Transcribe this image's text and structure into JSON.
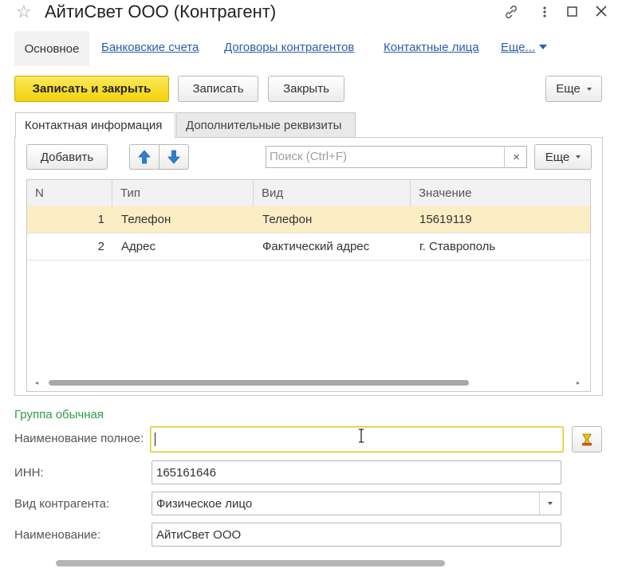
{
  "window": {
    "title": "АйтиСвет ООО (Контрагент)",
    "icons": [
      "star-icon",
      "link-icon",
      "more-vertical-icon",
      "maximize-icon",
      "close-icon"
    ]
  },
  "nav": {
    "tabs": [
      "Основное",
      "Банковские счета",
      "Договоры контрагентов",
      "Контактные лица",
      "Еще..."
    ]
  },
  "toolbar": {
    "save_close": "Записать и закрыть",
    "save": "Записать",
    "close": "Закрыть",
    "more": "Еще"
  },
  "tabs": {
    "contact": "Контактная информация",
    "extra": "Дополнительные реквизиты"
  },
  "table_toolbar": {
    "add": "Добавить",
    "search_placeholder": "Поиск (Ctrl+F)",
    "search_clear": "×",
    "more": "Еще"
  },
  "table": {
    "columns": [
      "N",
      "Тип",
      "Вид",
      "Значение"
    ],
    "rows": [
      {
        "n": "1",
        "type": "Телефон",
        "kind": "Телефон",
        "value": "15619119"
      },
      {
        "n": "2",
        "type": "Адрес",
        "kind": "Фактический адрес",
        "value": "г. Ставрополь"
      }
    ]
  },
  "form": {
    "group_title": "Группа обычная",
    "full_name_label": "Наименование полное:",
    "full_name_value": "",
    "inn_label": "ИНН:",
    "inn_value": "165161646",
    "kind_label": "Вид контрагента:",
    "kind_value": "Физическое лицо",
    "name_label": "Наименование:",
    "name_value": "АйтиСвет ООО"
  },
  "colors": {
    "primary_button": "#f3d20b",
    "link": "#2a5ea8",
    "selected_row": "#fbeec4",
    "group_title": "#2e9a4a",
    "focus_border": "#e6c92a",
    "arrow_icons": "#2e7fd6"
  }
}
